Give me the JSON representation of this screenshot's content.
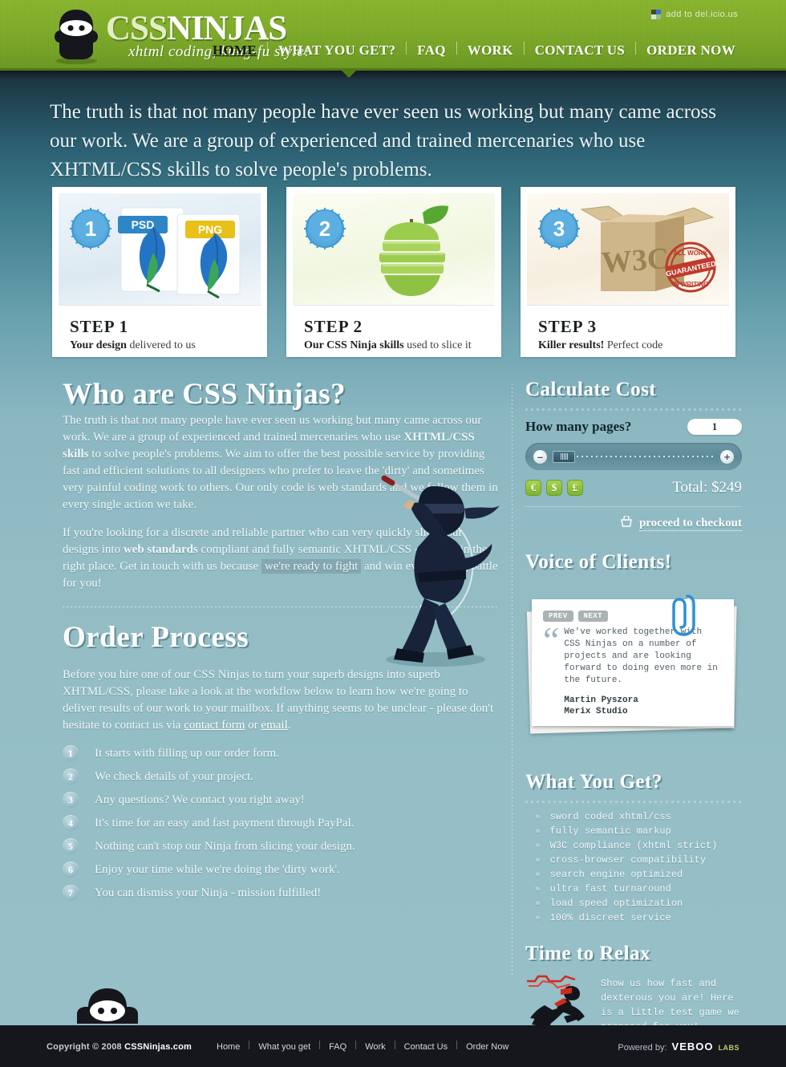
{
  "header": {
    "logo": {
      "title_css": "CSS",
      "title_ninjas": "NINJAS",
      "tagline": "xhtml coding, kung-fu style!",
      "icon": "ninja-logo-icon"
    },
    "delicious": {
      "label": "add to del.icio.us",
      "icon": "delicious-icon"
    },
    "nav": [
      {
        "label": "HOME",
        "active": true
      },
      {
        "label": "WHAT YOU GET?",
        "active": false
      },
      {
        "label": "FAQ",
        "active": false
      },
      {
        "label": "WORK",
        "active": false
      },
      {
        "label": "CONTACT US",
        "active": false
      },
      {
        "label": "ORDER NOW",
        "active": false
      }
    ]
  },
  "hero": {
    "text": "The truth is that not many people have ever seen us working but many came across our work. We are a group of experienced and trained mercenaries who use XHTML/CSS skills to solve people's problems."
  },
  "steps": [
    {
      "badge": "1",
      "title": "STEP 1",
      "strong": "Your design",
      "rest": " delivered to us",
      "image": "psd-png-feathers-icon"
    },
    {
      "badge": "2",
      "title": "STEP 2",
      "strong": "Our CSS Ninja skills",
      "rest": " used to slice it",
      "image": "sliced-apple-icon"
    },
    {
      "badge": "3",
      "title": "STEP 3",
      "strong": "Killer results!",
      "rest": " Perfect code",
      "image": "w3c-box-guaranteed-icon"
    }
  ],
  "who": {
    "heading": "Who are CSS Ninjas?",
    "p1_a": "The truth is that not many people have ever seen us working but many came across our work. We are a group of experienced and trained mercenaries who use ",
    "p1_b": "XHTML/CSS skills",
    "p1_c": " to solve people's problems. We aim to offer the best possible service by providing fast and efficient solutions to all designers who prefer to leave the 'dirty' and sometimes very painful coding work to others. Our only code is web standards and we follow them in every single action we take.",
    "p2_a": "If you're looking for a discrete and reliable partner who can very quickly slice your designs into ",
    "p2_b": "web standards",
    "p2_c": " compliant and fully semantic XHTML/CSS - you are in the right place. Get in touch with us because ",
    "p2_highlight": "we're ready to fight",
    "p2_d": " and win every coding battle for you!"
  },
  "order": {
    "heading": "Order Process",
    "intro_a": "Before you hire one of our CSS Ninjas to turn your superb designs into superb XHTML/CSS, please take a look at the workflow below to learn how we're going to deliver results of our work to your mailbox. If anything seems to be unclear - please don't hesitate to contact us via ",
    "link_contact": "contact form",
    "intro_b": " or ",
    "link_email": "email",
    "intro_c": ".",
    "steps": [
      {
        "n": "1",
        "text": "It starts with filling up our order form."
      },
      {
        "n": "2",
        "text": "We check details of your project."
      },
      {
        "n": "3",
        "text": "Any questions? We contact you right away!"
      },
      {
        "n": "4",
        "text": "It's time for an easy and fast payment through PayPal."
      },
      {
        "n": "5",
        "text": "Nothing can't stop our Ninja from slicing your design."
      },
      {
        "n": "6",
        "text": "Enjoy your time while we're doing the 'dirty work'."
      },
      {
        "n": "7",
        "text": "You can dismiss your Ninja - mission fulfilled!"
      }
    ]
  },
  "calc": {
    "heading": "Calculate Cost",
    "question": "How many pages?",
    "pages_value": "1",
    "minus": "–",
    "plus": "+",
    "currencies": [
      "€",
      "$",
      "£"
    ],
    "total_label": "Total: $249",
    "checkout_label": "proceed to checkout",
    "checkout_icon": "cart-icon"
  },
  "testimonial": {
    "heading": "Voice of Clients!",
    "prev": "PREV",
    "next": "NEXT",
    "quote_mark": "“",
    "quote": "We've worked together with CSS Ninjas on a number of projects and are looking forward to doing even more in the future.",
    "author": "Martin Pyszora",
    "company": "Merix Studio"
  },
  "what_you_get": {
    "heading": "What You Get?",
    "bullet": "»",
    "items": [
      "sword coded xhtml/css",
      "fully semantic markup",
      "W3C compliance (xhtml strict)",
      "cross-browser compatibility",
      "search engine optimized",
      "ultra fast turnaround",
      "load speed optimization",
      "100% discreet service"
    ]
  },
  "relax": {
    "heading": "Time to Relax",
    "text": "Show us how fast and dexterous you are! Here is a little test game we prepared for you!",
    "icon": "running-ninja-icon"
  },
  "footer": {
    "copyright_pre": "Copyright © 2008 ",
    "copyright_brand": "CSSNinjas.com",
    "nav": [
      "Home",
      "What you get",
      "FAQ",
      "Work",
      "Contact Us",
      "Order Now"
    ],
    "powered_label": "Powered by:",
    "powered_brand": "VEBOO",
    "powered_sup": "LABS"
  },
  "colors": {
    "header_green": "#82ae2c",
    "header_green_dark": "#4e7a18",
    "bg_dark_blue": "#1d3744",
    "bg_light_blue": "#96bfc7",
    "footer_dark": "#15171d",
    "badge_blue": "#3c97d4",
    "accent_green": "#8ec63f",
    "link_green": "#b6cf6a"
  }
}
